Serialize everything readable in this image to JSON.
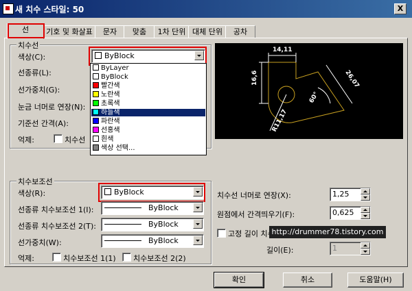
{
  "window": {
    "title": "새 치수 스타일: 50",
    "close_label": "X"
  },
  "tabs": [
    {
      "label": "선"
    },
    {
      "label": "기호 및 화살표"
    },
    {
      "label": "문자"
    },
    {
      "label": "맞춤"
    },
    {
      "label": "1차 단위"
    },
    {
      "label": "대체 단위"
    },
    {
      "label": "공차"
    }
  ],
  "dimension_lines": {
    "group_label": "치수선",
    "color_label": "색상(C):",
    "color_value": "ByBlock",
    "linetype_label": "선종류(L):",
    "lineweight_label": "선가중치(G):",
    "extend_label": "눈금 너머로 연장(N):",
    "baseline_label": "기준선 간격(A):",
    "suppress_label": "억제:",
    "suppress_dim1": "치수선"
  },
  "color_dropdown": {
    "items": [
      {
        "label": "ByLayer",
        "color": "#ffffff"
      },
      {
        "label": "ByBlock",
        "color": "#ffffff"
      },
      {
        "label": "빨간색",
        "color": "#ff0000"
      },
      {
        "label": "노란색",
        "color": "#ffff00"
      },
      {
        "label": "초록색",
        "color": "#00ff00"
      },
      {
        "label": "하늘색",
        "color": "#00ffff"
      },
      {
        "label": "파란색",
        "color": "#0000ff"
      },
      {
        "label": "선홍색",
        "color": "#ff00ff"
      },
      {
        "label": "흰색",
        "color": "#ffffff"
      },
      {
        "label": "색상 선택...",
        "color": "#808080"
      }
    ],
    "selected_index": 5
  },
  "preview": {
    "dim_top": "14,11",
    "dim_left": "16,6",
    "dim_right": "26,07",
    "dim_angle": "60°",
    "dim_radius": "R11,17",
    "colors": {
      "geometry": "#c8a020",
      "dimension": "#ffffff"
    }
  },
  "extension_lines": {
    "group_label": "치수보조선",
    "color_label": "색상(R):",
    "color_value": "ByBlock",
    "linetype1_label": "선종류 치수보조선 1(I):",
    "linetype1_value": "ByBlock",
    "linetype2_label": "선종류 치수보조선 2(T):",
    "linetype2_value": "ByBlock",
    "lineweight_label": "선가중치(W):",
    "lineweight_value": "ByBlock",
    "suppress_label": "억제:",
    "suppress_ext1": "치수보조선 1(1)",
    "suppress_ext2": "치수보조선 2(2)",
    "extend_beyond_label": "치수선 너머로 연장(X):",
    "extend_beyond_value": "1,25",
    "offset_label": "원점에서 간격띄우기(F):",
    "offset_value": "0,625",
    "fixed_length_label": "고정 길이 치수보조선(O)",
    "length_label": "길이(E):",
    "length_value": "1"
  },
  "buttons": {
    "ok": "확인",
    "cancel": "취소",
    "help": "도움말(H)"
  },
  "watermark": "http://drummer78.tistory.com"
}
